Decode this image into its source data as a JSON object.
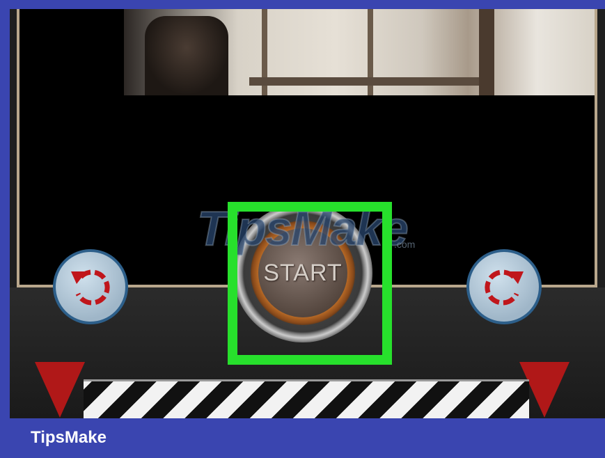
{
  "controls": {
    "start_label": "START",
    "undo_icon": "undo-arrow-icon",
    "redo_icon": "redo-arrow-icon"
  },
  "watermark": {
    "text": "TipsMake",
    "suffix": ".com"
  },
  "footer": {
    "brand": "TipsMake"
  },
  "colors": {
    "frame_blue": "#3a45b0",
    "highlight_green": "#27e02c",
    "arrow_red": "#c0161b",
    "button_blue_border": "#2d5f8a"
  }
}
